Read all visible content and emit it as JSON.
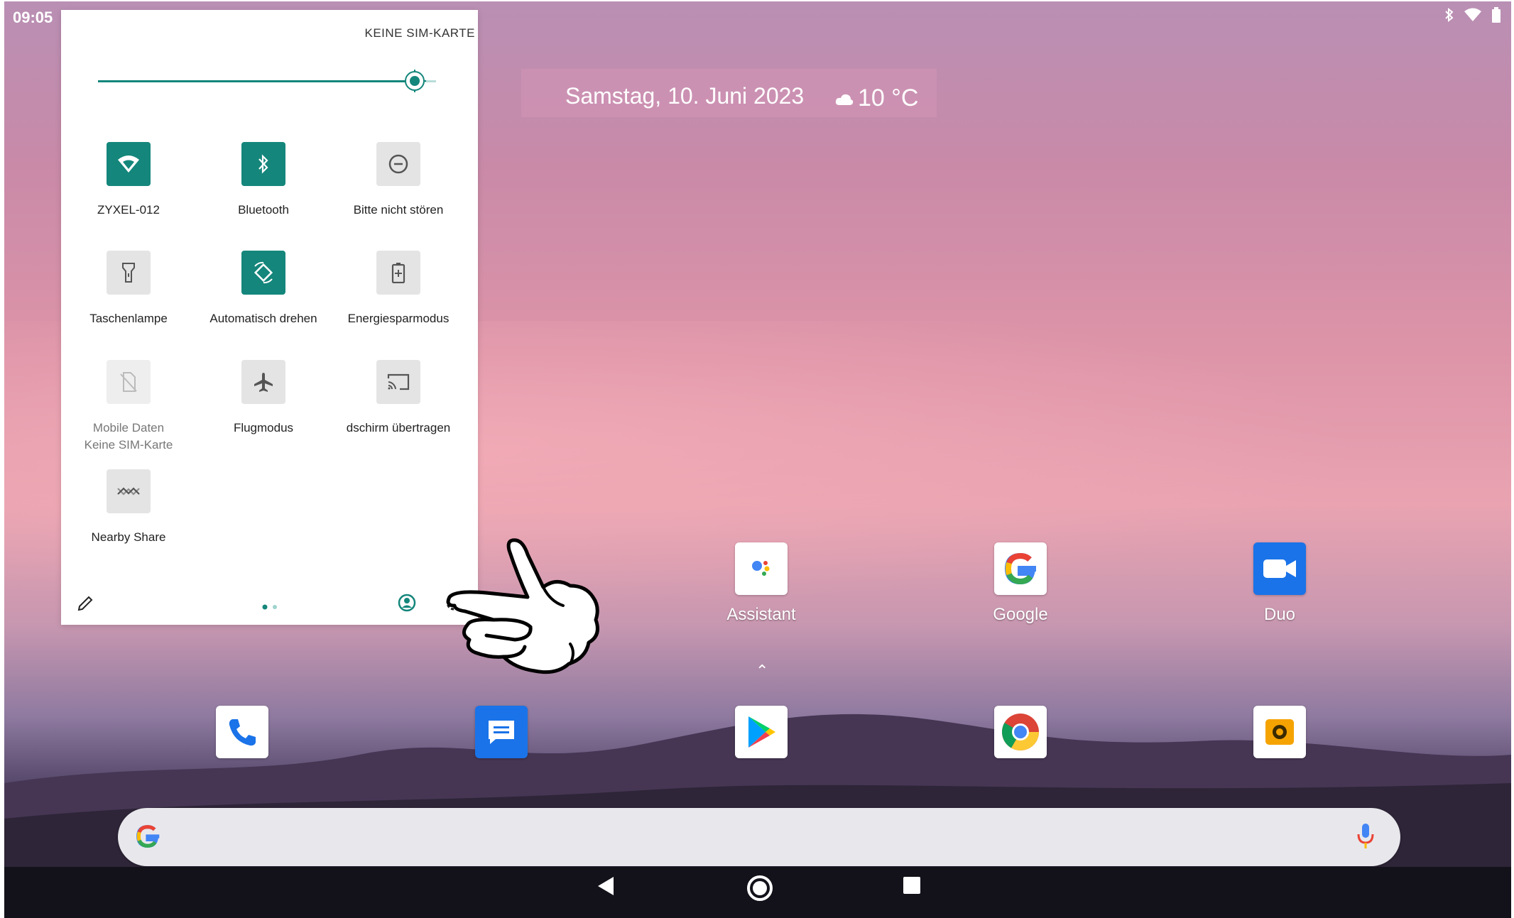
{
  "status_bar": {
    "time": "09:05",
    "icons": [
      "bluetooth-icon",
      "wifi-icon",
      "battery-icon"
    ]
  },
  "date_widget": {
    "date": "Samstag, 10. Juni 2023",
    "temperature": "10 °C",
    "weather_icon": "cloud-icon"
  },
  "quick_settings": {
    "sim_status": "KEINE SIM-KARTE",
    "brightness_level": 0.9,
    "tiles": [
      {
        "label": "ZYXEL-012",
        "icon": "wifi-icon",
        "state": "on"
      },
      {
        "label": "Bluetooth",
        "icon": "bluetooth-icon",
        "state": "on"
      },
      {
        "label": "Bitte nicht stören",
        "icon": "do-not-disturb-icon",
        "state": "off"
      },
      {
        "label": "Taschenlampe",
        "icon": "flashlight-icon",
        "state": "off"
      },
      {
        "label": "Automatisch drehen",
        "icon": "auto-rotate-icon",
        "state": "on"
      },
      {
        "label": "Energiesparmodus",
        "icon": "battery-saver-icon",
        "state": "off"
      },
      {
        "label": "Mobile Daten",
        "sublabel": "Keine SIM-Karte",
        "icon": "mobile-data-icon",
        "state": "unavailable"
      },
      {
        "label": "Flugmodus",
        "icon": "airplane-icon",
        "state": "off"
      },
      {
        "label": "dschirm übertragen",
        "icon": "cast-icon",
        "state": "off"
      },
      {
        "label": "Nearby Share",
        "icon": "nearby-share-icon",
        "state": "off"
      }
    ],
    "footer": {
      "edit_icon": "pencil-icon",
      "page_indicator": 2,
      "user_icon": "user-icon",
      "settings_icon": "gear-icon"
    }
  },
  "apps_row": [
    {
      "name": "Assistant",
      "icon": "assistant-icon"
    },
    {
      "name": "Google",
      "icon": "google-icon"
    },
    {
      "name": "Duo",
      "icon": "duo-icon"
    }
  ],
  "dock": [
    {
      "icon": "phone-icon"
    },
    {
      "icon": "messages-icon"
    },
    {
      "icon": "play-store-icon"
    },
    {
      "icon": "chrome-icon"
    },
    {
      "icon": "camera-icon"
    }
  ],
  "search_bar": {
    "logo": "google-g-icon",
    "mic": "mic-icon"
  },
  "nav_bar": {
    "buttons": [
      "back-button",
      "home-button",
      "recents-button"
    ]
  },
  "colors": {
    "accent": "#14867b",
    "search_bg": "#e8e8ec",
    "navbar": "#13111a"
  }
}
